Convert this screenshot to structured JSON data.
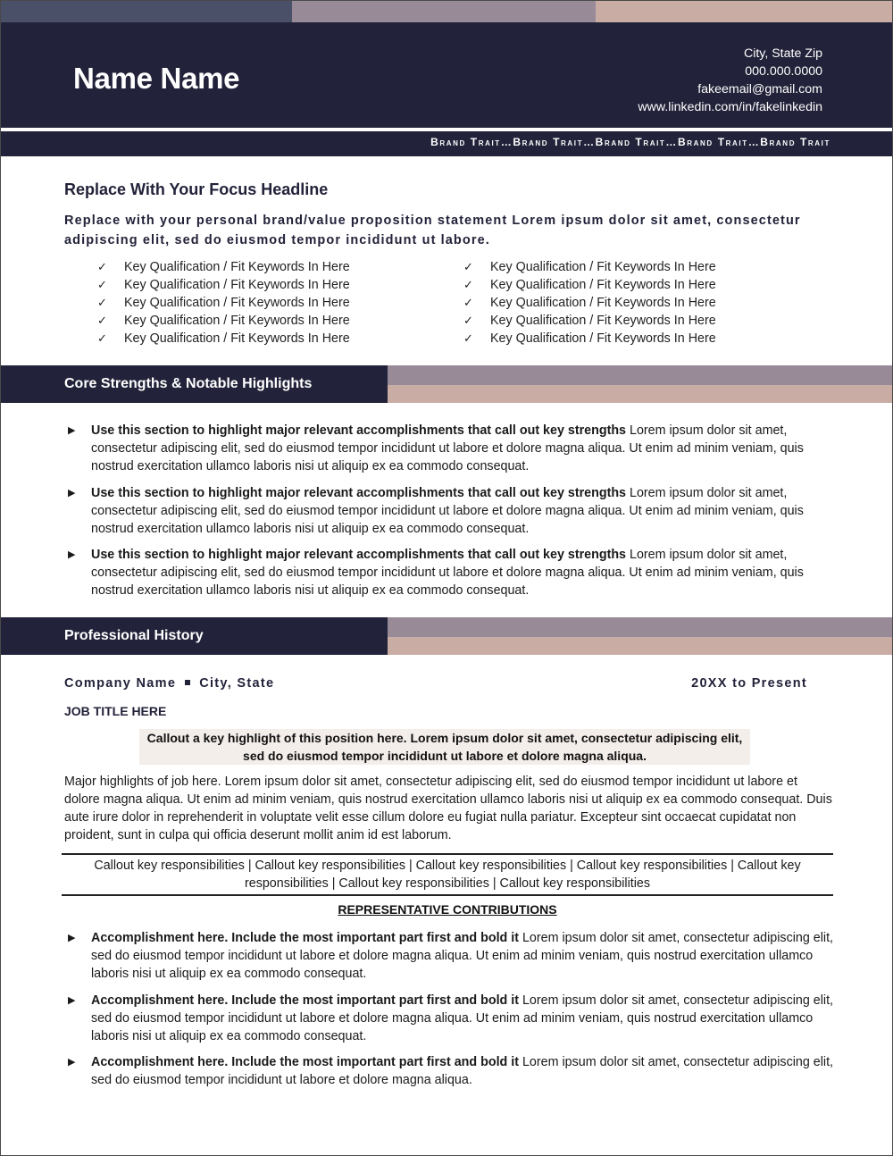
{
  "header": {
    "name": "Name Name",
    "contact": {
      "location": "City, State Zip",
      "phone": "000.000.0000",
      "email": "fakeemail@gmail.com",
      "linkedin": "www.linkedin.com/in/fakelinkedin"
    },
    "brand_traits": "Brand Trait…Brand Trait…Brand Trait…Brand Trait…Brand Trait"
  },
  "summary": {
    "headline": "Replace With Your Focus Headline",
    "brand_statement": "Replace with your personal brand/value proposition statement Lorem ipsum dolor sit amet, consectetur adipiscing elit, sed do eiusmod tempor incididunt ut labore.",
    "check_icon": "✓",
    "qualifications_left": [
      "Key Qualification / Fit Keywords In Here",
      "Key Qualification / Fit Keywords In Here",
      "Key Qualification / Fit Keywords In Here",
      "Key Qualification / Fit Keywords In Here",
      "Key Qualification / Fit Keywords In Here"
    ],
    "qualifications_right": [
      "Key Qualification / Fit Keywords In Here",
      "Key Qualification / Fit Keywords In Here",
      "Key Qualification / Fit Keywords In Here",
      "Key Qualification / Fit Keywords In Here",
      "Key Qualification / Fit Keywords In Here"
    ]
  },
  "core_strengths": {
    "title": "Core Strengths & Notable Highlights",
    "bullet_icon": "▶",
    "items": [
      {
        "bold": "Use this section to highlight major relevant accomplishments that call out key strengths",
        "text": " Lorem ipsum dolor sit amet, consectetur adipiscing elit, sed do eiusmod tempor incididunt ut labore et dolore magna aliqua. Ut enim ad minim veniam, quis nostrud exercitation ullamco laboris nisi ut aliquip ex ea commodo consequat."
      },
      {
        "bold": "Use this section to highlight major relevant accomplishments that call out key strengths",
        "text": " Lorem ipsum dolor sit amet, consectetur adipiscing elit, sed do eiusmod tempor incididunt ut labore et dolore magna aliqua. Ut enim ad minim veniam, quis nostrud exercitation ullamco laboris nisi ut aliquip ex ea commodo consequat."
      },
      {
        "bold": "Use this section to highlight major relevant accomplishments that call out key strengths",
        "text": " Lorem ipsum dolor sit amet, consectetur adipiscing elit, sed do eiusmod tempor incididunt ut labore et dolore magna aliqua. Ut enim ad minim veniam, quis nostrud exercitation ullamco laboris nisi ut aliquip ex ea commodo consequat."
      }
    ]
  },
  "history": {
    "title": "Professional History",
    "company": "Company Name",
    "location": "City, State",
    "dates": "20XX to Present",
    "job_title": "JOB TITLE HERE",
    "callout": "Callout a key highlight of this position here. Lorem ipsum dolor sit amet, consectetur adipiscing elit, sed do eiusmod tempor incididunt ut labore et dolore magna aliqua.",
    "major_highlights": "Major highlights of job here. Lorem ipsum dolor sit amet, consectetur adipiscing elit, sed do eiusmod tempor incididunt ut labore et dolore magna aliqua. Ut enim ad minim veniam, quis nostrud exercitation ullamco laboris nisi ut aliquip ex ea commodo consequat. Duis aute irure dolor in reprehenderit in voluptate velit esse cillum dolore eu fugiat nulla pariatur. Excepteur sint occaecat cupidatat non proident, sunt in culpa qui officia deserunt mollit anim id est laborum.",
    "responsibilities": "Callout key responsibilities | Callout key responsibilities | Callout key responsibilities | Callout key responsibilities | Callout key responsibilities | Callout key responsibilities | Callout key responsibilities",
    "contributions_heading": "REPRESENTATIVE CONTRIBUTIONS",
    "contributions": [
      {
        "bold": "Accomplishment here. Include the most important part first and bold it",
        "text": "  Lorem ipsum dolor sit amet, consectetur adipiscing elit, sed do eiusmod tempor incididunt ut labore et dolore magna aliqua. Ut enim ad minim veniam, quis nostrud exercitation ullamco laboris nisi ut aliquip ex ea commodo consequat."
      },
      {
        "bold": "Accomplishment here. Include the most important part first and bold it",
        "text": "  Lorem ipsum dolor sit amet, consectetur adipiscing elit, sed do eiusmod tempor incididunt ut labore et dolore magna aliqua. Ut enim ad minim veniam, quis nostrud exercitation ullamco laboris nisi ut aliquip ex ea commodo consequat."
      },
      {
        "bold": "Accomplishment here. Include the most important part first and bold it",
        "text": "  Lorem ipsum dolor sit amet, consectetur adipiscing elit, sed do eiusmod tempor incididunt ut labore et dolore magna aliqua."
      }
    ]
  },
  "colors": {
    "navy": "#22223a",
    "slate": "#4b5069",
    "mauve": "#998a98",
    "rose": "#c9ada5",
    "callout_bg": "#f4eeeb"
  }
}
